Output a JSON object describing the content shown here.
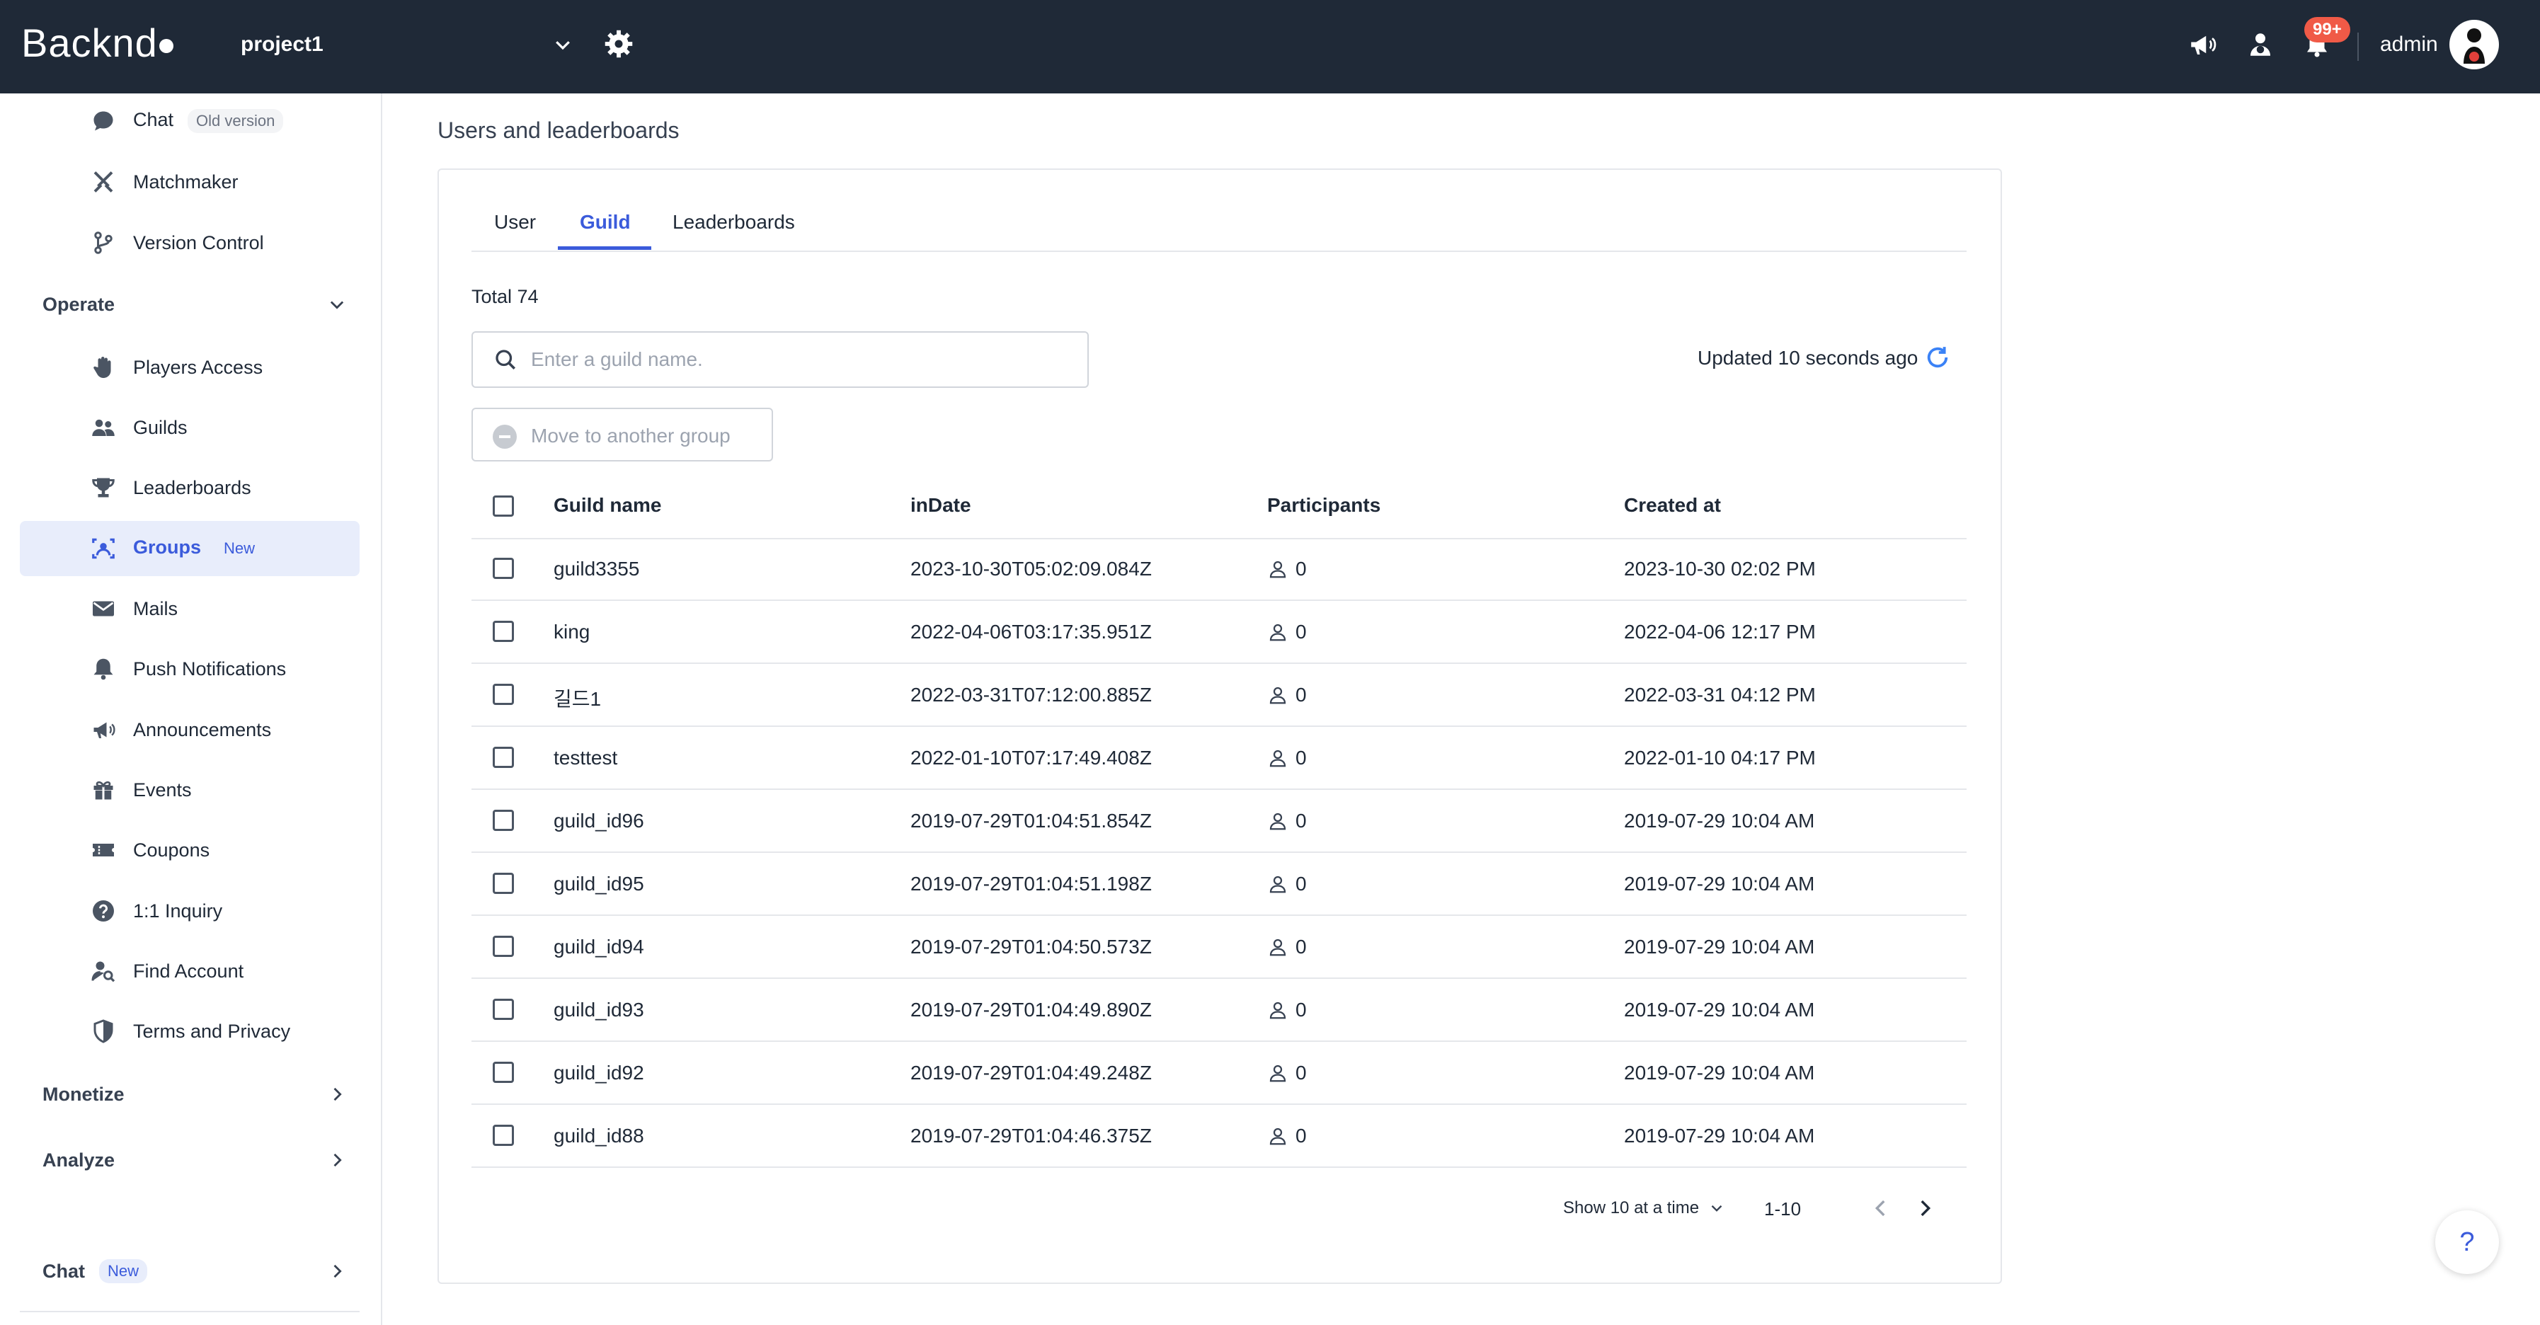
{
  "header": {
    "logo_text": "Backnd",
    "project": "project1",
    "badge": "99+",
    "user": "admin"
  },
  "sidebar": {
    "top_items": [
      {
        "label": "Chat",
        "pill": "Old version",
        "icon": "chat-icon"
      },
      {
        "label": "Matchmaker",
        "icon": "matchmaker-icon"
      },
      {
        "label": "Version Control",
        "icon": "branch-icon"
      }
    ],
    "operate_label": "Operate",
    "operate_items": [
      {
        "label": "Players Access",
        "icon": "hand-icon"
      },
      {
        "label": "Guilds",
        "icon": "users-icon"
      },
      {
        "label": "Leaderboards",
        "icon": "trophy-icon"
      },
      {
        "label": "Groups",
        "pill": "New",
        "icon": "group-icon"
      },
      {
        "label": "Mails",
        "icon": "mail-icon"
      },
      {
        "label": "Push Notifications",
        "icon": "bell-icon"
      },
      {
        "label": "Announcements",
        "icon": "megaphone-icon"
      },
      {
        "label": "Events",
        "icon": "gift-icon"
      },
      {
        "label": "Coupons",
        "icon": "ticket-icon"
      },
      {
        "label": "1:1 Inquiry",
        "icon": "question-icon"
      },
      {
        "label": "Find Account",
        "icon": "find-user-icon"
      },
      {
        "label": "Terms and Privacy",
        "icon": "shield-icon"
      }
    ],
    "monetize_label": "Monetize",
    "analyze_label": "Analyze",
    "chat_label": "Chat",
    "chat_pill": "New"
  },
  "main": {
    "title": "Users and leaderboards",
    "tabs": [
      "User",
      "Guild",
      "Leaderboards"
    ],
    "total": "Total 74",
    "search_placeholder": "Enter a guild name.",
    "updated": "Updated 10 seconds ago",
    "move_button": "Move to another group",
    "columns": [
      "Guild name",
      "inDate",
      "Participants",
      "Created at"
    ],
    "rows": [
      {
        "name": "guild3355",
        "indate": "2023-10-30T05:02:09.084Z",
        "participants": "0",
        "created": "2023-10-30 02:02 PM"
      },
      {
        "name": "king",
        "indate": "2022-04-06T03:17:35.951Z",
        "participants": "0",
        "created": "2022-04-06 12:17 PM"
      },
      {
        "name": "길드1",
        "indate": "2022-03-31T07:12:00.885Z",
        "participants": "0",
        "created": "2022-03-31 04:12 PM"
      },
      {
        "name": "testtest",
        "indate": "2022-01-10T07:17:49.408Z",
        "participants": "0",
        "created": "2022-01-10 04:17 PM"
      },
      {
        "name": "guild_id96",
        "indate": "2019-07-29T01:04:51.854Z",
        "participants": "0",
        "created": "2019-07-29 10:04 AM"
      },
      {
        "name": "guild_id95",
        "indate": "2019-07-29T01:04:51.198Z",
        "participants": "0",
        "created": "2019-07-29 10:04 AM"
      },
      {
        "name": "guild_id94",
        "indate": "2019-07-29T01:04:50.573Z",
        "participants": "0",
        "created": "2019-07-29 10:04 AM"
      },
      {
        "name": "guild_id93",
        "indate": "2019-07-29T01:04:49.890Z",
        "participants": "0",
        "created": "2019-07-29 10:04 AM"
      },
      {
        "name": "guild_id92",
        "indate": "2019-07-29T01:04:49.248Z",
        "participants": "0",
        "created": "2019-07-29 10:04 AM"
      },
      {
        "name": "guild_id88",
        "indate": "2019-07-29T01:04:46.375Z",
        "participants": "0",
        "created": "2019-07-29 10:04 AM"
      }
    ],
    "pager": {
      "size_label": "Show 10 at a time",
      "range": "1-10"
    }
  },
  "help_label": "?",
  "colors": {
    "header_bg": "#1f2937",
    "accent": "#3b5bdb",
    "badge": "#f05a47",
    "active_bg": "#e8edfb"
  }
}
